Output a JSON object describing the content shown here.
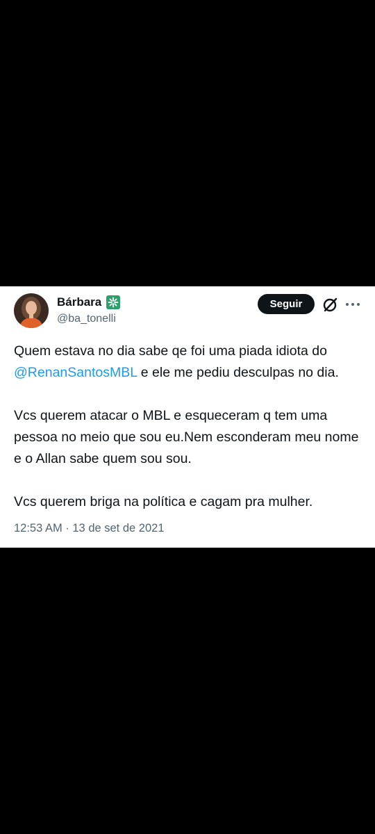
{
  "tweet": {
    "author": {
      "display_name": "Bárbara",
      "handle": "@ba_tonelli",
      "badge_icon": "sparkle-badge-icon",
      "badge_color": "#2e9e6b"
    },
    "follow_label": "Seguir",
    "paragraphs": {
      "p1_text_a": "Quem estava no dia sabe qe foi uma piada idiota do",
      "p1_mention": "@RenanSantosMBL",
      "p1_text_b": " e ele me pediu desculpas no dia.",
      "p2": "Vcs querem atacar o MBL e  esqueceram q tem uma pessoa no meio que sou eu.Nem esconderam meu nome e o Allan sabe quem sou sou.",
      "p3": "Vcs querem briga na política e cagam pra mulher."
    },
    "timestamp": "12:53 AM · 13 de set de 2021",
    "colors": {
      "mention": "#1d9bf0",
      "text": "#0f1419",
      "secondary": "#536471",
      "button_bg": "#0f1419"
    },
    "icons": [
      "x-logo-icon",
      "more-icon"
    ]
  }
}
